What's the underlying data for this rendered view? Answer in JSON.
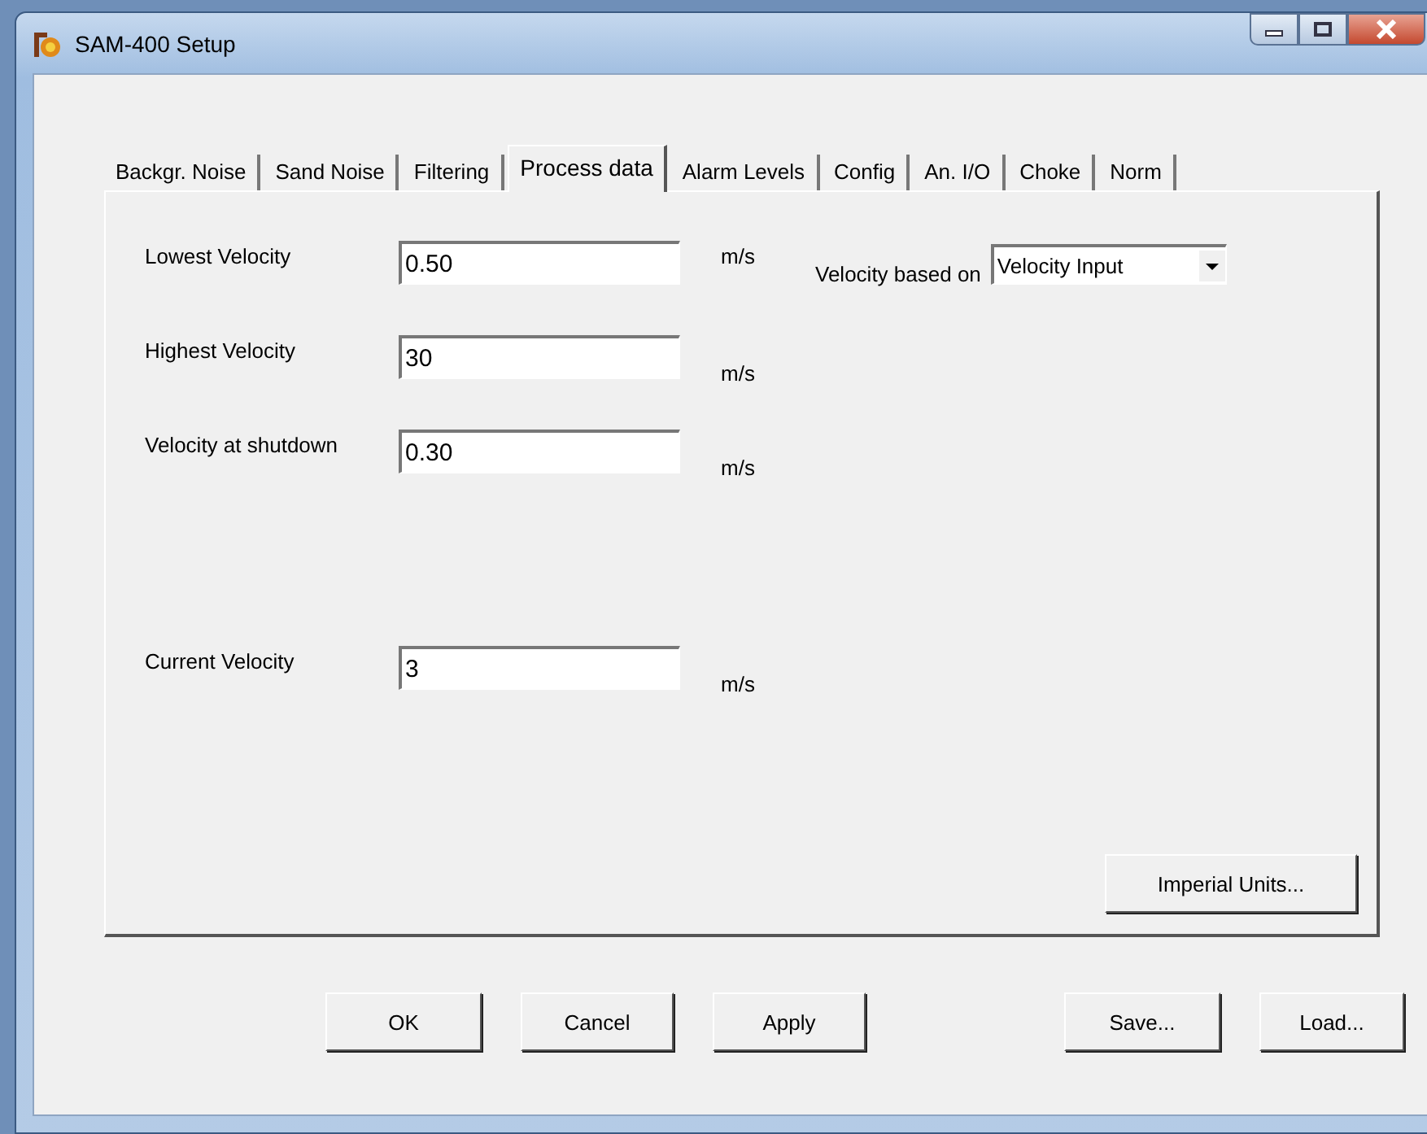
{
  "window": {
    "title": "SAM-400 Setup"
  },
  "tabs": [
    {
      "label": "Backgr. Noise",
      "selected": false
    },
    {
      "label": "Sand Noise",
      "selected": false
    },
    {
      "label": "Filtering",
      "selected": false
    },
    {
      "label": "Process data",
      "selected": true
    },
    {
      "label": "Alarm Levels",
      "selected": false
    },
    {
      "label": "Config",
      "selected": false
    },
    {
      "label": "An. I/O",
      "selected": false
    },
    {
      "label": "Choke",
      "selected": false
    },
    {
      "label": "Norm",
      "selected": false
    }
  ],
  "fields": [
    {
      "label": "Lowest Velocity",
      "value": "0.50",
      "unit": "m/s"
    },
    {
      "label": "Highest Velocity",
      "value": "30",
      "unit": "m/s"
    },
    {
      "label": "Velocity at shutdown",
      "value": "0.30",
      "unit": "m/s"
    },
    {
      "label": "Current Velocity",
      "value": "3",
      "unit": "m/s"
    }
  ],
  "velocity_based_on": {
    "label": "Velocity based on",
    "value": "Velocity Input"
  },
  "imperial_button": "Imperial Units...",
  "buttons": [
    "OK",
    "Cancel",
    "Apply"
  ],
  "file_buttons": [
    "Save...",
    "Load..."
  ]
}
